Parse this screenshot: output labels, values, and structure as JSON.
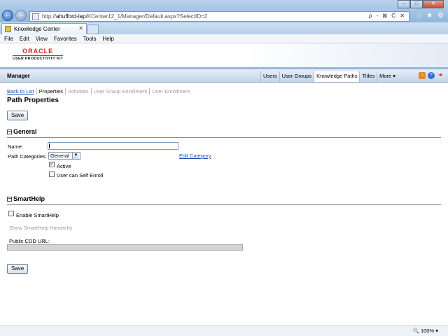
{
  "browser": {
    "url_prefix": "http://",
    "url_host": "ahufford-lap",
    "url_rest": "/KCenter12_1/Manager/Default.aspx?SelectID=2",
    "address_tools": "ρ - ⊠ C ✕",
    "tab_title": "Knowledge Center",
    "window_buttons": [
      "–",
      "□",
      "✕"
    ],
    "menu": [
      "File",
      "Edit",
      "View",
      "Favorites",
      "Tools",
      "Help"
    ],
    "zoom": "100%"
  },
  "brand": {
    "oracle": "ORACLE",
    "product": "USER PRODUCTIVITY KIT"
  },
  "navbar": {
    "title": "Manager",
    "tabs": [
      "Users",
      "User Groups",
      "Knowledge Paths",
      "Titles",
      "More ▾"
    ],
    "active_tab": "Knowledge Paths"
  },
  "subnav": {
    "back": "Back to List",
    "properties": "Properties",
    "activities": "Activities",
    "ug_enrollment": "User Group Enrollment",
    "user_enrollment": "User Enrollment"
  },
  "page": {
    "title": "Path Properties",
    "save_label": "Save"
  },
  "general": {
    "heading": "General",
    "collapse_glyph": "−",
    "name_label": "Name:",
    "name_value": "",
    "categories_label": "Path Categories:",
    "category_value": "General",
    "edit_category": "Edit Category",
    "active_label": "Active",
    "active_checked": true,
    "self_enroll_label": "User can Self Enroll",
    "self_enroll_checked": false
  },
  "smarthelp": {
    "heading": "SmartHelp",
    "collapse_glyph": "−",
    "enable_label": "Enable SmartHelp",
    "enable_checked": false,
    "hierarchy_label": "Show SmartHelp Hierarchy",
    "cdd_label": "Public CDD URL:",
    "cdd_value": ""
  },
  "colors": {
    "link": "#1f4fb0",
    "oracle_red": "#d21f1b",
    "disabled": "#9a9a9a"
  }
}
